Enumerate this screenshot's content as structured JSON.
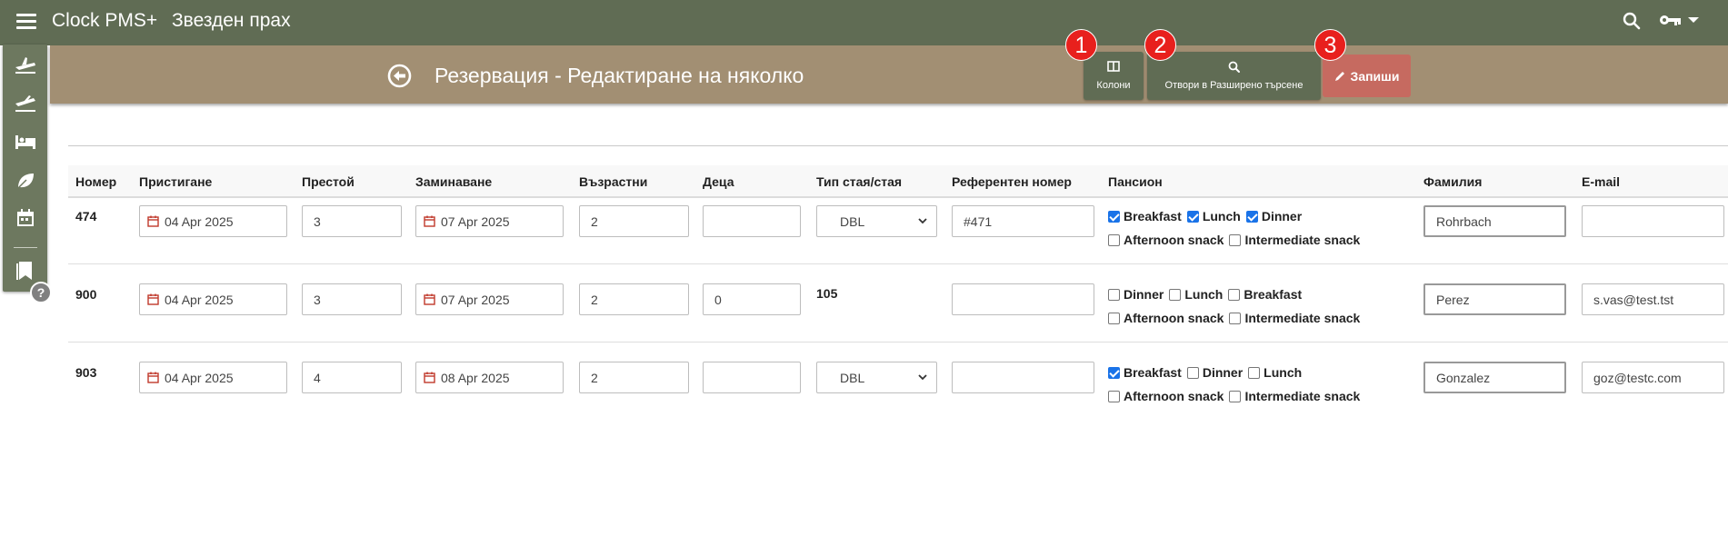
{
  "app": {
    "title": "Clock PMS+",
    "hotel": "Звезден прах"
  },
  "icons": {
    "menu": "hamburger-menu-icon",
    "search": "search-icon",
    "key": "key-icon",
    "back": "back-arrow-circle-icon",
    "columns": "columns-icon",
    "save": "pencil-icon"
  },
  "colors": {
    "topbar": "#606c54",
    "header_band": "#a28f73",
    "save": "#c66a60",
    "badge": "#e8201d",
    "checkbox": "#1a73e8"
  },
  "header": {
    "title": "Резервация - Редактиране на няколко",
    "columns_label": "Колони",
    "adv_search_label": "Отвори в Разширено търсене",
    "save_label": "Запиши",
    "badges": [
      "1",
      "2",
      "3"
    ]
  },
  "sidebar": {
    "items": [
      "arrivals-icon",
      "departures-icon",
      "bed-icon",
      "leaf-icon",
      "calendar-icon",
      "bookmark-icon"
    ],
    "help": "?"
  },
  "table": {
    "columns": [
      "Номер",
      "Пристигане",
      "Престой",
      "Заминаване",
      "Възрастни",
      "Деца",
      "Тип стая/стая",
      "Референтен номер",
      "Пансион",
      "Фамилия",
      "E-mail"
    ],
    "rows": [
      {
        "number": "474",
        "arrival": "04 Apr 2025",
        "stay": "3",
        "departure": "07 Apr 2025",
        "adults": "2",
        "children": "",
        "room": "DBL",
        "room_is_select": true,
        "reference": "#471",
        "board_line1": [
          {
            "label": "Breakfast",
            "checked": true
          },
          {
            "label": "Lunch",
            "checked": true
          },
          {
            "label": "Dinner",
            "checked": true
          }
        ],
        "board_line2": [
          {
            "label": "Afternoon snack",
            "checked": false
          },
          {
            "label": "Intermediate snack",
            "checked": false
          }
        ],
        "surname": "Rohrbach",
        "email": ""
      },
      {
        "number": "900",
        "arrival": "04 Apr 2025",
        "stay": "3",
        "departure": "07 Apr 2025",
        "adults": "2",
        "children": "0",
        "room": "105",
        "room_is_select": false,
        "reference": "",
        "board_line1": [
          {
            "label": "Dinner",
            "checked": false
          },
          {
            "label": "Lunch",
            "checked": false
          },
          {
            "label": "Breakfast",
            "checked": false
          }
        ],
        "board_line2": [
          {
            "label": "Afternoon snack",
            "checked": false
          },
          {
            "label": "Intermediate snack",
            "checked": false
          }
        ],
        "surname": "Perez",
        "email": "s.vas@test.tst"
      },
      {
        "number": "903",
        "arrival": "04 Apr 2025",
        "stay": "4",
        "departure": "08 Apr 2025",
        "adults": "2",
        "children": "",
        "room": "DBL",
        "room_is_select": true,
        "reference": "",
        "board_line1": [
          {
            "label": "Breakfast",
            "checked": true
          },
          {
            "label": "Dinner",
            "checked": false
          },
          {
            "label": "Lunch",
            "checked": false
          }
        ],
        "board_line2": [
          {
            "label": "Afternoon snack",
            "checked": false
          },
          {
            "label": "Intermediate snack",
            "checked": false
          }
        ],
        "surname": "Gonzalez",
        "email": "goz@testc.com"
      }
    ]
  }
}
